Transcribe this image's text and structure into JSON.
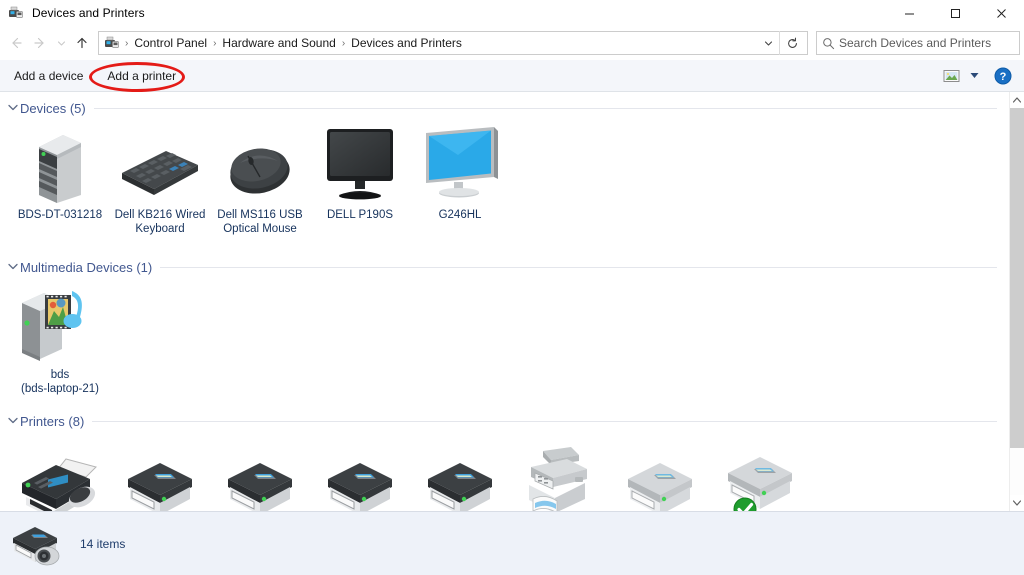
{
  "window": {
    "title": "Devices and Printers",
    "title_icon": "devices-and-printers-icon",
    "minimize_label": "—",
    "maximize_label": "☐",
    "close_label": "✕"
  },
  "addressbar": {
    "back_label": "←",
    "forward_label": "→",
    "recent_label": "⌄",
    "up_label": "↑",
    "crumb_icon": "devices-and-printers-icon",
    "separator": "›",
    "crumbs": [
      "Control Panel",
      "Hardware and Sound",
      "Devices and Printers"
    ],
    "dropdown_label": "⌄",
    "refresh_label": "↻",
    "search": {
      "placeholder": "Search Devices and Printers",
      "value": "",
      "icon": "search-icon"
    }
  },
  "toolbar": {
    "add_device_label": "Add a device",
    "add_printer_label": "Add a printer",
    "view_icon": "view-options-icon",
    "caret_label": "▼",
    "help_label": "?"
  },
  "annotation": {
    "type": "ellipse",
    "color": "#e41b17",
    "targets": "Add a printer"
  },
  "groups": [
    {
      "name": "devices",
      "title": "Devices (5)",
      "count": 5,
      "chevron": "⌄",
      "items": [
        {
          "label": "BDS-DT-031218",
          "icon": "desktop-tower-icon",
          "state": "normal"
        },
        {
          "label": "Dell KB216 Wired Keyboard",
          "icon": "keyboard-icon",
          "state": "normal"
        },
        {
          "label": "Dell MS116 USB Optical Mouse",
          "icon": "mouse-icon",
          "state": "normal"
        },
        {
          "label": "DELL P190S",
          "icon": "monitor-off-icon",
          "state": "normal"
        },
        {
          "label": "G246HL",
          "icon": "monitor-on-icon",
          "state": "normal"
        }
      ]
    },
    {
      "name": "multimedia-devices",
      "title": "Multimedia Devices (1)",
      "count": 1,
      "chevron": "⌄",
      "items": [
        {
          "label": "bds\n(bds-laptop-21)",
          "icon": "media-device-icon",
          "state": "normal"
        }
      ]
    },
    {
      "name": "printers",
      "title": "Printers (8)",
      "count": 8,
      "chevron": "⌄",
      "items": [
        {
          "label": "",
          "icon": "fax-printer-icon",
          "state": "online"
        },
        {
          "label": "",
          "icon": "printer-icon",
          "state": "online"
        },
        {
          "label": "",
          "icon": "printer-icon",
          "state": "online"
        },
        {
          "label": "",
          "icon": "printer-icon",
          "state": "online"
        },
        {
          "label": "",
          "icon": "printer-icon",
          "state": "online"
        },
        {
          "label": "",
          "icon": "multifunction-printer-icon",
          "state": "offline"
        },
        {
          "label": "",
          "icon": "printer-icon",
          "state": "offline"
        },
        {
          "label": "",
          "icon": "printer-icon",
          "state": "default",
          "badge": "default-printer-check"
        }
      ]
    }
  ],
  "statusbar": {
    "icon": "printer-scanner-icon",
    "items_text": "14 items"
  },
  "scrollbar": {
    "up_label": "▲",
    "down_label": "▼"
  }
}
